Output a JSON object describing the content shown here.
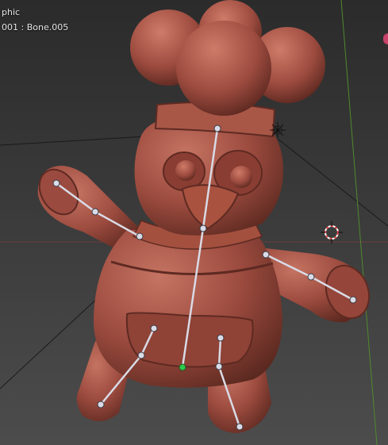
{
  "viewport": {
    "view_label": "phic",
    "object_label": "001 : Bone.005"
  },
  "colors": {
    "background_top": "#2c2c2c",
    "background_bottom": "#4b4b4b",
    "model": "#9a4a3f",
    "model_light": "#c06a5a",
    "model_dark": "#5e2a22",
    "bone": "#d9dbe6",
    "active_joint": "#2ec84a",
    "grid_line": "#1a1a1a",
    "axis_red": "#8a3a3a",
    "axis_green": "#4f8a2e",
    "cursor_red": "#e04040",
    "corner_handle": "#c7436a"
  },
  "icons": [
    "3d-cursor-icon",
    "light-icon"
  ]
}
